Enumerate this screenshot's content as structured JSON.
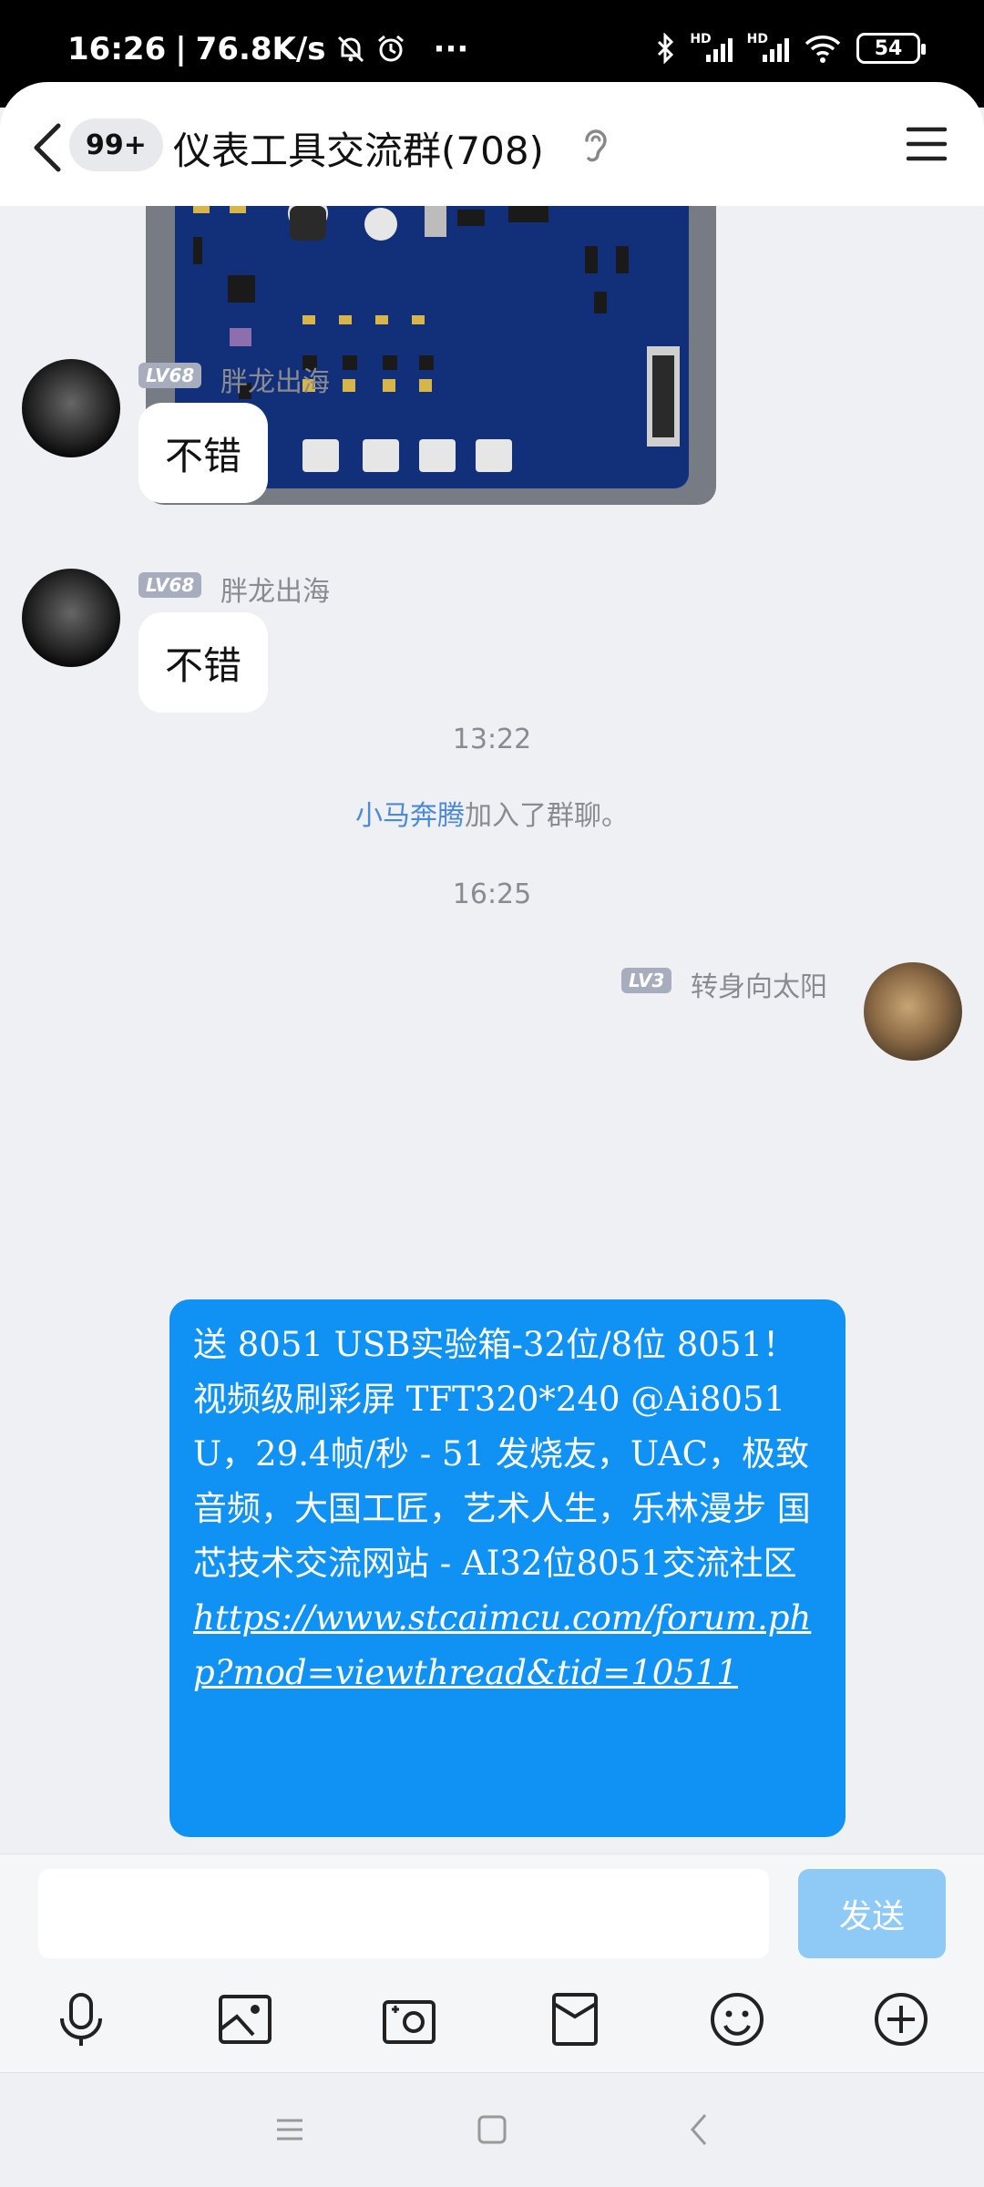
{
  "status_bar": {
    "time": "16:26",
    "speed": "76.8K/s",
    "dots": "···",
    "hd1": "HD",
    "hd2": "HD",
    "battery": "54"
  },
  "header": {
    "unread": "99+",
    "title": "仪表工具交流群(708)"
  },
  "messages": {
    "m1": {
      "level": "LV68",
      "sender": "胖龙出海",
      "text": "不错"
    },
    "m2": {
      "level": "LV68",
      "sender": "胖龙出海",
      "text": "不错"
    },
    "time1": "13:22",
    "join": {
      "name": "小马奔腾",
      "suffix": "加入了群聊。"
    },
    "time2": "16:25",
    "m3": {
      "level": "LV3",
      "sender": "转身向太阳",
      "text": "送 8051 USB实验箱-32位/8位 8051！视频级刷彩屏 TFT320*240 @Ai8051U，29.4帧/秒 - 51 发烧友，UAC，极致音频，大国工匠，艺术人生，乐林漫步 国芯技术交流网站 - AI32位8051交流社区 ",
      "url": "https://www.stcaimcu.com/forum.php?mod=viewthread&tid=10511"
    }
  },
  "input": {
    "send_label": "发送"
  },
  "colors": {
    "accent": "#1092f5",
    "send_disabled": "#8fcaf7",
    "link": "#4b8ad7"
  }
}
